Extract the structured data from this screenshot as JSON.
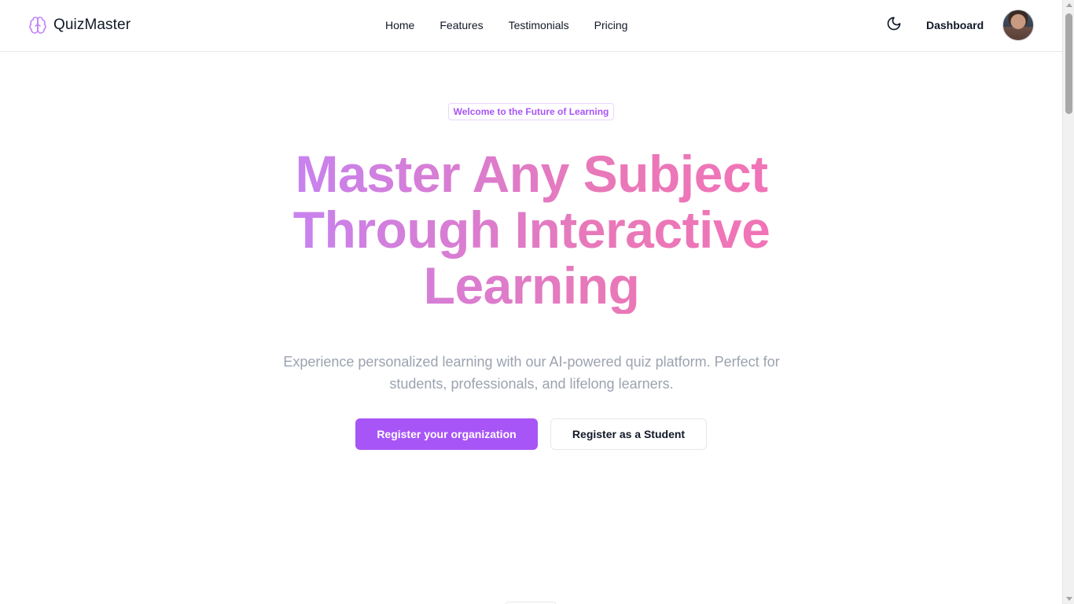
{
  "header": {
    "brand_name": "QuizMaster",
    "brand_icon": "brain-icon",
    "nav": [
      "Home",
      "Features",
      "Testimonials",
      "Pricing"
    ],
    "theme_icon": "moon-icon",
    "dashboard_label": "Dashboard"
  },
  "hero": {
    "badge": "Welcome to the Future of Learning",
    "headline_line1": "Master Any Subject",
    "headline_line2": "Through Interactive",
    "headline_line3": "Learning",
    "subtext": "Experience personalized learning with our AI-powered quiz platform. Perfect for students, professionals, and lifelong learners.",
    "primary_cta": "Register your organization",
    "secondary_cta": "Register as a Student"
  },
  "colors": {
    "accent": "#a855f7",
    "gradient_start": "#c084fc",
    "gradient_end": "#f472b6",
    "muted_text": "#9ca3af"
  }
}
